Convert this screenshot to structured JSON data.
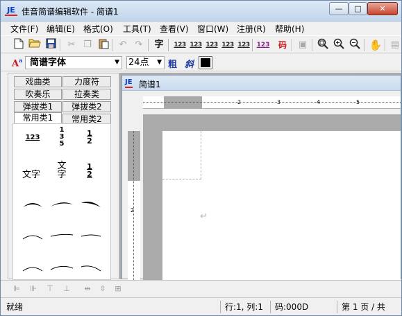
{
  "window": {
    "title": "佳音简谱编辑软件 - 简谱1",
    "logo_text": "JE",
    "controls": {
      "minimize": "—",
      "maximize": "□",
      "close": "✕"
    }
  },
  "menu": [
    "文件(F)",
    "编辑(E)",
    "格式(O)",
    "工具(T)",
    "查看(V)",
    "窗口(W)",
    "注册(R)",
    "帮助(H)"
  ],
  "toolbar": {
    "char_button": "字",
    "num_labels": [
      "123",
      "123",
      "123",
      "123",
      "123"
    ],
    "purple_label": "123",
    "code_button": "码"
  },
  "format_bar": {
    "font_icon": "A",
    "font_icon_sup": "a",
    "font_name": "简谱字体",
    "font_size": "24点",
    "bold": "粗",
    "italic": "斜",
    "color": "#000000"
  },
  "palette": {
    "tabs": [
      {
        "label": "戏曲类"
      },
      {
        "label": "力度符"
      },
      {
        "label": "吹奏乐"
      },
      {
        "label": "拉奏类"
      },
      {
        "label": "弹拔类1"
      },
      {
        "label": "弹拔类2"
      },
      {
        "label": "常用类1"
      },
      {
        "label": "常用类2"
      }
    ],
    "cells": {
      "c1": "123",
      "c2a": "1",
      "c2b": "3",
      "c2c": "5",
      "c3a": "1",
      "c3b": "2",
      "c4": "文字",
      "c5a": "文",
      "c5b": "字",
      "c6a": "1",
      "c6b": "2"
    }
  },
  "document": {
    "title": "简谱1",
    "ruler_numbers": [
      "2",
      "3",
      "4",
      "5"
    ],
    "vruler_number": "2",
    "paragraph_mark": "↵"
  },
  "status": {
    "ready": "就绪",
    "position": "行:1, 列:1",
    "code": "码:000D",
    "page": "第 1 页 / 共"
  }
}
